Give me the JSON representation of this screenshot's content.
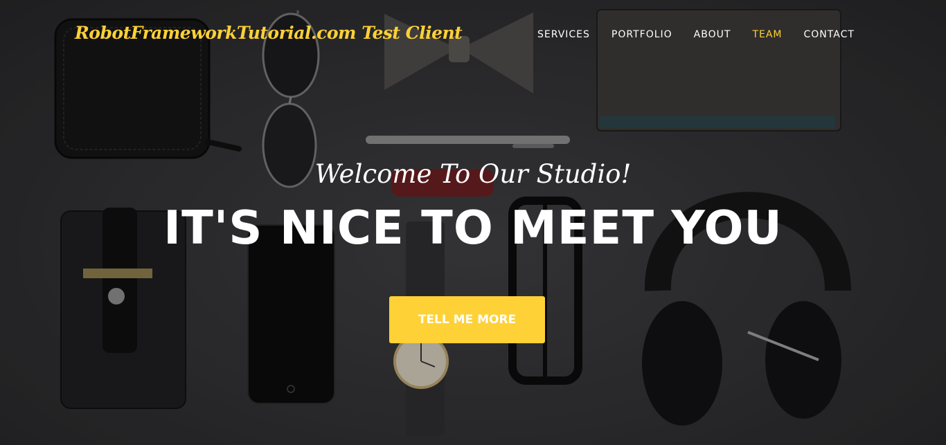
{
  "brand": {
    "text": "RobotFrameworkTutorial.com Test Client"
  },
  "nav": {
    "items": [
      {
        "label": "SERVICES"
      },
      {
        "label": "PORTFOLIO"
      },
      {
        "label": "ABOUT"
      },
      {
        "label": "TEAM",
        "active": true
      },
      {
        "label": "CONTACT"
      }
    ]
  },
  "hero": {
    "lead_in": "Welcome To Our Studio!",
    "heading": "IT'S NICE TO MEET YOU",
    "cta_label": "TELL ME MORE"
  },
  "colors": {
    "accent": "#fed136",
    "text": "#ffffff",
    "background": "#2b2b2d"
  }
}
